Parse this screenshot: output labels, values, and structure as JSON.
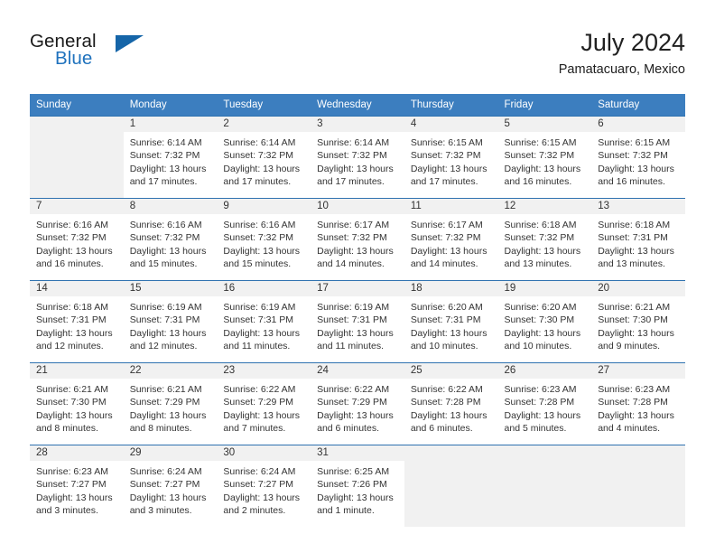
{
  "brand": {
    "line1": "General",
    "line2": "Blue",
    "triangle_color": "#1565a8",
    "blue_color": "#1f72bd"
  },
  "header": {
    "title": "July 2024",
    "location": "Pamatacuaro, Mexico"
  },
  "theme": {
    "header_row_bg": "#3c7ebf",
    "daynum_bg": "#f1f1f1",
    "grid_line": "#2f72b0"
  },
  "weekday_headers": [
    "Sunday",
    "Monday",
    "Tuesday",
    "Wednesday",
    "Thursday",
    "Friday",
    "Saturday"
  ],
  "weeks": [
    [
      {
        "day": "",
        "sunrise": "",
        "sunset": "",
        "daylight1": "",
        "daylight2": ""
      },
      {
        "day": "1",
        "sunrise": "Sunrise: 6:14 AM",
        "sunset": "Sunset: 7:32 PM",
        "daylight1": "Daylight: 13 hours",
        "daylight2": "and 17 minutes."
      },
      {
        "day": "2",
        "sunrise": "Sunrise: 6:14 AM",
        "sunset": "Sunset: 7:32 PM",
        "daylight1": "Daylight: 13 hours",
        "daylight2": "and 17 minutes."
      },
      {
        "day": "3",
        "sunrise": "Sunrise: 6:14 AM",
        "sunset": "Sunset: 7:32 PM",
        "daylight1": "Daylight: 13 hours",
        "daylight2": "and 17 minutes."
      },
      {
        "day": "4",
        "sunrise": "Sunrise: 6:15 AM",
        "sunset": "Sunset: 7:32 PM",
        "daylight1": "Daylight: 13 hours",
        "daylight2": "and 17 minutes."
      },
      {
        "day": "5",
        "sunrise": "Sunrise: 6:15 AM",
        "sunset": "Sunset: 7:32 PM",
        "daylight1": "Daylight: 13 hours",
        "daylight2": "and 16 minutes."
      },
      {
        "day": "6",
        "sunrise": "Sunrise: 6:15 AM",
        "sunset": "Sunset: 7:32 PM",
        "daylight1": "Daylight: 13 hours",
        "daylight2": "and 16 minutes."
      }
    ],
    [
      {
        "day": "7",
        "sunrise": "Sunrise: 6:16 AM",
        "sunset": "Sunset: 7:32 PM",
        "daylight1": "Daylight: 13 hours",
        "daylight2": "and 16 minutes."
      },
      {
        "day": "8",
        "sunrise": "Sunrise: 6:16 AM",
        "sunset": "Sunset: 7:32 PM",
        "daylight1": "Daylight: 13 hours",
        "daylight2": "and 15 minutes."
      },
      {
        "day": "9",
        "sunrise": "Sunrise: 6:16 AM",
        "sunset": "Sunset: 7:32 PM",
        "daylight1": "Daylight: 13 hours",
        "daylight2": "and 15 minutes."
      },
      {
        "day": "10",
        "sunrise": "Sunrise: 6:17 AM",
        "sunset": "Sunset: 7:32 PM",
        "daylight1": "Daylight: 13 hours",
        "daylight2": "and 14 minutes."
      },
      {
        "day": "11",
        "sunrise": "Sunrise: 6:17 AM",
        "sunset": "Sunset: 7:32 PM",
        "daylight1": "Daylight: 13 hours",
        "daylight2": "and 14 minutes."
      },
      {
        "day": "12",
        "sunrise": "Sunrise: 6:18 AM",
        "sunset": "Sunset: 7:32 PM",
        "daylight1": "Daylight: 13 hours",
        "daylight2": "and 13 minutes."
      },
      {
        "day": "13",
        "sunrise": "Sunrise: 6:18 AM",
        "sunset": "Sunset: 7:31 PM",
        "daylight1": "Daylight: 13 hours",
        "daylight2": "and 13 minutes."
      }
    ],
    [
      {
        "day": "14",
        "sunrise": "Sunrise: 6:18 AM",
        "sunset": "Sunset: 7:31 PM",
        "daylight1": "Daylight: 13 hours",
        "daylight2": "and 12 minutes."
      },
      {
        "day": "15",
        "sunrise": "Sunrise: 6:19 AM",
        "sunset": "Sunset: 7:31 PM",
        "daylight1": "Daylight: 13 hours",
        "daylight2": "and 12 minutes."
      },
      {
        "day": "16",
        "sunrise": "Sunrise: 6:19 AM",
        "sunset": "Sunset: 7:31 PM",
        "daylight1": "Daylight: 13 hours",
        "daylight2": "and 11 minutes."
      },
      {
        "day": "17",
        "sunrise": "Sunrise: 6:19 AM",
        "sunset": "Sunset: 7:31 PM",
        "daylight1": "Daylight: 13 hours",
        "daylight2": "and 11 minutes."
      },
      {
        "day": "18",
        "sunrise": "Sunrise: 6:20 AM",
        "sunset": "Sunset: 7:31 PM",
        "daylight1": "Daylight: 13 hours",
        "daylight2": "and 10 minutes."
      },
      {
        "day": "19",
        "sunrise": "Sunrise: 6:20 AM",
        "sunset": "Sunset: 7:30 PM",
        "daylight1": "Daylight: 13 hours",
        "daylight2": "and 10 minutes."
      },
      {
        "day": "20",
        "sunrise": "Sunrise: 6:21 AM",
        "sunset": "Sunset: 7:30 PM",
        "daylight1": "Daylight: 13 hours",
        "daylight2": "and 9 minutes."
      }
    ],
    [
      {
        "day": "21",
        "sunrise": "Sunrise: 6:21 AM",
        "sunset": "Sunset: 7:30 PM",
        "daylight1": "Daylight: 13 hours",
        "daylight2": "and 8 minutes."
      },
      {
        "day": "22",
        "sunrise": "Sunrise: 6:21 AM",
        "sunset": "Sunset: 7:29 PM",
        "daylight1": "Daylight: 13 hours",
        "daylight2": "and 8 minutes."
      },
      {
        "day": "23",
        "sunrise": "Sunrise: 6:22 AM",
        "sunset": "Sunset: 7:29 PM",
        "daylight1": "Daylight: 13 hours",
        "daylight2": "and 7 minutes."
      },
      {
        "day": "24",
        "sunrise": "Sunrise: 6:22 AM",
        "sunset": "Sunset: 7:29 PM",
        "daylight1": "Daylight: 13 hours",
        "daylight2": "and 6 minutes."
      },
      {
        "day": "25",
        "sunrise": "Sunrise: 6:22 AM",
        "sunset": "Sunset: 7:28 PM",
        "daylight1": "Daylight: 13 hours",
        "daylight2": "and 6 minutes."
      },
      {
        "day": "26",
        "sunrise": "Sunrise: 6:23 AM",
        "sunset": "Sunset: 7:28 PM",
        "daylight1": "Daylight: 13 hours",
        "daylight2": "and 5 minutes."
      },
      {
        "day": "27",
        "sunrise": "Sunrise: 6:23 AM",
        "sunset": "Sunset: 7:28 PM",
        "daylight1": "Daylight: 13 hours",
        "daylight2": "and 4 minutes."
      }
    ],
    [
      {
        "day": "28",
        "sunrise": "Sunrise: 6:23 AM",
        "sunset": "Sunset: 7:27 PM",
        "daylight1": "Daylight: 13 hours",
        "daylight2": "and 3 minutes."
      },
      {
        "day": "29",
        "sunrise": "Sunrise: 6:24 AM",
        "sunset": "Sunset: 7:27 PM",
        "daylight1": "Daylight: 13 hours",
        "daylight2": "and 3 minutes."
      },
      {
        "day": "30",
        "sunrise": "Sunrise: 6:24 AM",
        "sunset": "Sunset: 7:27 PM",
        "daylight1": "Daylight: 13 hours",
        "daylight2": "and 2 minutes."
      },
      {
        "day": "31",
        "sunrise": "Sunrise: 6:25 AM",
        "sunset": "Sunset: 7:26 PM",
        "daylight1": "Daylight: 13 hours",
        "daylight2": "and 1 minute."
      },
      {
        "day": "",
        "sunrise": "",
        "sunset": "",
        "daylight1": "",
        "daylight2": ""
      },
      {
        "day": "",
        "sunrise": "",
        "sunset": "",
        "daylight1": "",
        "daylight2": ""
      },
      {
        "day": "",
        "sunrise": "",
        "sunset": "",
        "daylight1": "",
        "daylight2": ""
      }
    ]
  ]
}
